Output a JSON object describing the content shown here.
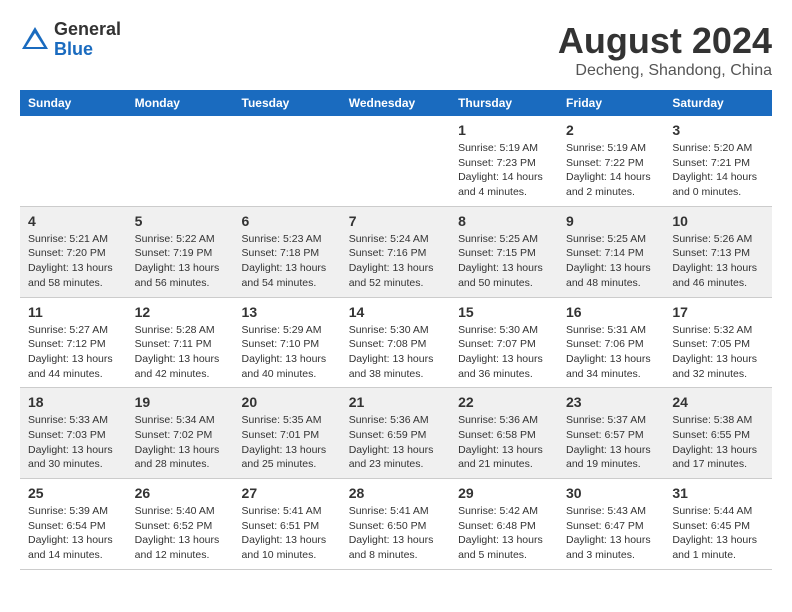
{
  "header": {
    "logo_general": "General",
    "logo_blue": "Blue",
    "month_year": "August 2024",
    "location": "Decheng, Shandong, China"
  },
  "calendar": {
    "days_of_week": [
      "Sunday",
      "Monday",
      "Tuesday",
      "Wednesday",
      "Thursday",
      "Friday",
      "Saturday"
    ],
    "weeks": [
      [
        {
          "day": "",
          "info": ""
        },
        {
          "day": "",
          "info": ""
        },
        {
          "day": "",
          "info": ""
        },
        {
          "day": "",
          "info": ""
        },
        {
          "day": "1",
          "info": "Sunrise: 5:19 AM\nSunset: 7:23 PM\nDaylight: 14 hours\nand 4 minutes."
        },
        {
          "day": "2",
          "info": "Sunrise: 5:19 AM\nSunset: 7:22 PM\nDaylight: 14 hours\nand 2 minutes."
        },
        {
          "day": "3",
          "info": "Sunrise: 5:20 AM\nSunset: 7:21 PM\nDaylight: 14 hours\nand 0 minutes."
        }
      ],
      [
        {
          "day": "4",
          "info": "Sunrise: 5:21 AM\nSunset: 7:20 PM\nDaylight: 13 hours\nand 58 minutes."
        },
        {
          "day": "5",
          "info": "Sunrise: 5:22 AM\nSunset: 7:19 PM\nDaylight: 13 hours\nand 56 minutes."
        },
        {
          "day": "6",
          "info": "Sunrise: 5:23 AM\nSunset: 7:18 PM\nDaylight: 13 hours\nand 54 minutes."
        },
        {
          "day": "7",
          "info": "Sunrise: 5:24 AM\nSunset: 7:16 PM\nDaylight: 13 hours\nand 52 minutes."
        },
        {
          "day": "8",
          "info": "Sunrise: 5:25 AM\nSunset: 7:15 PM\nDaylight: 13 hours\nand 50 minutes."
        },
        {
          "day": "9",
          "info": "Sunrise: 5:25 AM\nSunset: 7:14 PM\nDaylight: 13 hours\nand 48 minutes."
        },
        {
          "day": "10",
          "info": "Sunrise: 5:26 AM\nSunset: 7:13 PM\nDaylight: 13 hours\nand 46 minutes."
        }
      ],
      [
        {
          "day": "11",
          "info": "Sunrise: 5:27 AM\nSunset: 7:12 PM\nDaylight: 13 hours\nand 44 minutes."
        },
        {
          "day": "12",
          "info": "Sunrise: 5:28 AM\nSunset: 7:11 PM\nDaylight: 13 hours\nand 42 minutes."
        },
        {
          "day": "13",
          "info": "Sunrise: 5:29 AM\nSunset: 7:10 PM\nDaylight: 13 hours\nand 40 minutes."
        },
        {
          "day": "14",
          "info": "Sunrise: 5:30 AM\nSunset: 7:08 PM\nDaylight: 13 hours\nand 38 minutes."
        },
        {
          "day": "15",
          "info": "Sunrise: 5:30 AM\nSunset: 7:07 PM\nDaylight: 13 hours\nand 36 minutes."
        },
        {
          "day": "16",
          "info": "Sunrise: 5:31 AM\nSunset: 7:06 PM\nDaylight: 13 hours\nand 34 minutes."
        },
        {
          "day": "17",
          "info": "Sunrise: 5:32 AM\nSunset: 7:05 PM\nDaylight: 13 hours\nand 32 minutes."
        }
      ],
      [
        {
          "day": "18",
          "info": "Sunrise: 5:33 AM\nSunset: 7:03 PM\nDaylight: 13 hours\nand 30 minutes."
        },
        {
          "day": "19",
          "info": "Sunrise: 5:34 AM\nSunset: 7:02 PM\nDaylight: 13 hours\nand 28 minutes."
        },
        {
          "day": "20",
          "info": "Sunrise: 5:35 AM\nSunset: 7:01 PM\nDaylight: 13 hours\nand 25 minutes."
        },
        {
          "day": "21",
          "info": "Sunrise: 5:36 AM\nSunset: 6:59 PM\nDaylight: 13 hours\nand 23 minutes."
        },
        {
          "day": "22",
          "info": "Sunrise: 5:36 AM\nSunset: 6:58 PM\nDaylight: 13 hours\nand 21 minutes."
        },
        {
          "day": "23",
          "info": "Sunrise: 5:37 AM\nSunset: 6:57 PM\nDaylight: 13 hours\nand 19 minutes."
        },
        {
          "day": "24",
          "info": "Sunrise: 5:38 AM\nSunset: 6:55 PM\nDaylight: 13 hours\nand 17 minutes."
        }
      ],
      [
        {
          "day": "25",
          "info": "Sunrise: 5:39 AM\nSunset: 6:54 PM\nDaylight: 13 hours\nand 14 minutes."
        },
        {
          "day": "26",
          "info": "Sunrise: 5:40 AM\nSunset: 6:52 PM\nDaylight: 13 hours\nand 12 minutes."
        },
        {
          "day": "27",
          "info": "Sunrise: 5:41 AM\nSunset: 6:51 PM\nDaylight: 13 hours\nand 10 minutes."
        },
        {
          "day": "28",
          "info": "Sunrise: 5:41 AM\nSunset: 6:50 PM\nDaylight: 13 hours\nand 8 minutes."
        },
        {
          "day": "29",
          "info": "Sunrise: 5:42 AM\nSunset: 6:48 PM\nDaylight: 13 hours\nand 5 minutes."
        },
        {
          "day": "30",
          "info": "Sunrise: 5:43 AM\nSunset: 6:47 PM\nDaylight: 13 hours\nand 3 minutes."
        },
        {
          "day": "31",
          "info": "Sunrise: 5:44 AM\nSunset: 6:45 PM\nDaylight: 13 hours\nand 1 minute."
        }
      ]
    ]
  }
}
